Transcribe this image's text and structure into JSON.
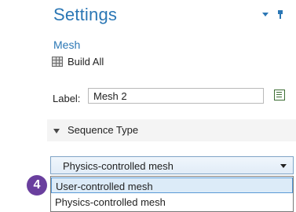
{
  "header": {
    "title": "Settings",
    "subtitle": "Mesh"
  },
  "toolbar": {
    "build_all_label": "Build All"
  },
  "label_field": {
    "label": "Label:",
    "value": "Mesh 2"
  },
  "section": {
    "title": "Sequence Type"
  },
  "sequence_select": {
    "selected": "Physics-controlled mesh",
    "options": [
      "User-controlled mesh",
      "Physics-controlled mesh"
    ],
    "highlighted_index": 0
  },
  "badge": {
    "number": "4"
  },
  "colors": {
    "accent": "#2b77b5",
    "badge": "#6a3f9e",
    "highlight": "#dcebf8"
  },
  "icons": [
    "collapse-icon",
    "pin-icon",
    "build-all-icon",
    "edit-label-icon",
    "section-collapse-icon",
    "dropdown-arrow-icon"
  ]
}
